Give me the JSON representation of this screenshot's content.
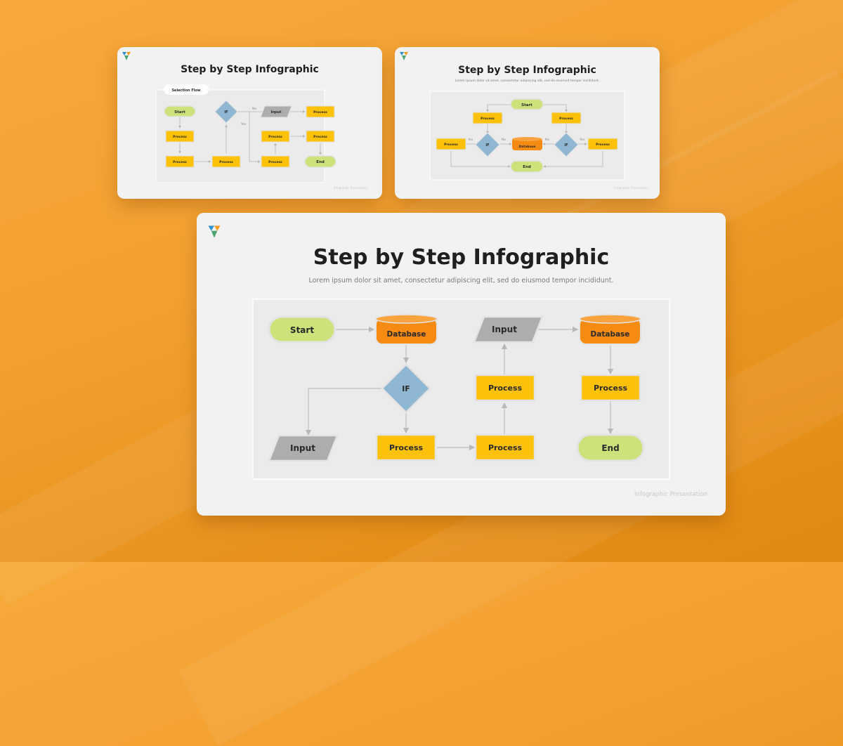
{
  "background": {
    "color": "#f2a030"
  },
  "colors": {
    "process": "#fcc10a",
    "terminal": "#cde27a",
    "decision": "#8fb6d3",
    "io": "#adadad",
    "database": "#f68b14",
    "panel": "#ebebeb"
  },
  "slides": [
    {
      "id": "slide-1",
      "title": "Step by Step Infographic",
      "tag": "Selection Flow",
      "footer": "Infographic Presentation",
      "nodes": {
        "start": "Start",
        "p1": "Process",
        "p2": "Process",
        "p3": "Process",
        "if": "IF",
        "input": "Input",
        "p4": "Process",
        "p5": "Process",
        "p6": "Process",
        "p7": "Process",
        "end": "End"
      },
      "edge_labels": {
        "no": "No",
        "yes": "Yes"
      }
    },
    {
      "id": "slide-2",
      "title": "Step by Step Infographic",
      "subtitle": "Lorem ipsum dolor sit amet, consectetur adipiscing elit, sed do eiusmod tempor incididunt.",
      "footer": "Infographic Presentation",
      "nodes": {
        "start": "Start",
        "pl": "Process",
        "pr": "Process",
        "pfl": "Process",
        "ifl": "IF",
        "db": "Database",
        "ifr": "IF",
        "pfr": "Process",
        "end": "End"
      },
      "edge_labels": {
        "yes": "Yes",
        "no": "No"
      }
    },
    {
      "id": "slide-3",
      "title": "Step by Step Infographic",
      "subtitle": "Lorem ipsum dolor sit amet, consectetur adipiscing elit, sed do eiusmod tempor incididunt.",
      "footer": "Infographic Presentation",
      "nodes": {
        "start": "Start",
        "db1": "Database",
        "if": "IF",
        "input_left": "Input",
        "p1": "Process",
        "p2": "Process",
        "p3": "Process",
        "input_top": "Input",
        "db2": "Database",
        "p4": "Process",
        "end": "End"
      }
    }
  ]
}
